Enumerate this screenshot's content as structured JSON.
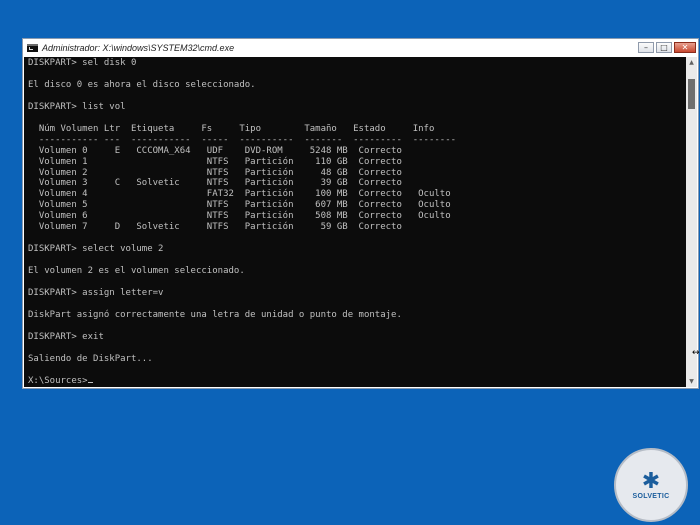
{
  "window": {
    "title": "Administrador: X:\\windows\\SYSTEM32\\cmd.exe",
    "controls": {
      "minimize": "–",
      "maximize": "□",
      "close": "✕"
    }
  },
  "console": {
    "lines": [
      "DISKPART> sel disk 0",
      "",
      "El disco 0 es ahora el disco seleccionado.",
      "",
      "DISKPART> list vol",
      "",
      "  Núm Volumen Ltr  Etiqueta     Fs     Tipo        Tamaño   Estado     Info",
      "  ----------- ---  -----------  -----  ----------  -------  ---------  --------",
      "  Volumen 0     E   CCCOMA_X64   UDF    DVD-ROM     5248 MB  Correcto",
      "  Volumen 1                      NTFS   Partición    110 GB  Correcto",
      "  Volumen 2                      NTFS   Partición     48 GB  Correcto",
      "  Volumen 3     C   Solvetic     NTFS   Partición     39 GB  Correcto",
      "  Volumen 4                      FAT32  Partición    100 MB  Correcto   Oculto",
      "  Volumen 5                      NTFS   Partición    607 MB  Correcto   Oculto",
      "  Volumen 6                      NTFS   Partición    508 MB  Correcto   Oculto",
      "  Volumen 7     D   Solvetic     NTFS   Partición     59 GB  Correcto",
      "",
      "DISKPART> select volume 2",
      "",
      "El volumen 2 es el volumen seleccionado.",
      "",
      "DISKPART> assign letter=v",
      "",
      "DiskPart asignó correctamente una letra de unidad o punto de montaje.",
      "",
      "DISKPART> exit",
      "",
      "Saliendo de DiskPart...",
      ""
    ],
    "prompt": "X:\\Sources>"
  },
  "logo": {
    "mark": "✱",
    "text": "SOLVETIC"
  },
  "colors": {
    "desktop": "#0c63b8",
    "console_bg": "#0c0c0c",
    "console_fg": "#c0c0c0"
  }
}
